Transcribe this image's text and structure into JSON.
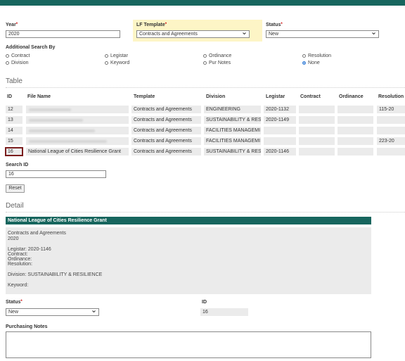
{
  "form": {
    "year_label": "Year",
    "year_value": "2020",
    "template_label": "LF Template",
    "template_value": "Contracts and Agreements",
    "status_label": "Status",
    "status_value": "New",
    "additional_label": "Additional Search By",
    "radios": [
      {
        "label": "Contract",
        "checked": false
      },
      {
        "label": "Legistar",
        "checked": false
      },
      {
        "label": "Ordinance",
        "checked": false
      },
      {
        "label": "Resolution",
        "checked": false
      },
      {
        "label": "Division",
        "checked": false
      },
      {
        "label": "Keyword",
        "checked": false
      },
      {
        "label": "Pur Notes",
        "checked": false
      },
      {
        "label": "None",
        "checked": true
      }
    ]
  },
  "table": {
    "section_title": "Table",
    "headers": [
      "ID",
      "File Name",
      "Template",
      "Division",
      "Legistar",
      "Contract",
      "Ordinance",
      "Resolution"
    ],
    "rows": [
      {
        "id": "12",
        "file_name": "",
        "template": "Contracts and Agreements",
        "division": "ENGINEERING",
        "legistar": "2020-1132",
        "contract": "",
        "ordinance": "",
        "resolution": "115-20"
      },
      {
        "id": "13",
        "file_name": "",
        "template": "Contracts and Agreements",
        "division": "SUSTAINABILITY & RES",
        "legistar": "2020-1149",
        "contract": "",
        "ordinance": "",
        "resolution": ""
      },
      {
        "id": "14",
        "file_name": "",
        "template": "Contracts and Agreements",
        "division": "FACILITIES MANAGEMI",
        "legistar": "",
        "contract": "",
        "ordinance": "",
        "resolution": ""
      },
      {
        "id": "15",
        "file_name": "",
        "template": "Contracts and Agreements",
        "division": "FACILITIES MANAGEMI",
        "legistar": "",
        "contract": "",
        "ordinance": "",
        "resolution": "223-20"
      },
      {
        "id": "16",
        "file_name": "National League of Cities Resilience Grant",
        "template": "Contracts and Agreements",
        "division": "SUSTAINABILITY & RES",
        "legistar": "2020-1146",
        "contract": "",
        "ordinance": "",
        "resolution": ""
      }
    ]
  },
  "search": {
    "label": "Search ID",
    "value": "16",
    "reset_label": "Reset"
  },
  "detail": {
    "section_title": "Detail",
    "header": "National League of Cities Resilience Grant",
    "template": "Contracts and Agreements",
    "year": "2020",
    "legistar": "Legistar: 2020-1146",
    "contract": "Contract:",
    "ordinance": "Ordinance:",
    "resolution": "Resolution:",
    "division": "Division: SUSTAINABILITY & RESILIENCE",
    "keyword": "Keyword:",
    "status_label": "Status",
    "status_value": "New",
    "id_label": "ID",
    "id_value": "16",
    "notes_label": "Purchasing Notes",
    "notes_value": ""
  },
  "colors": {
    "header_bar": "#17665e",
    "highlight": "#fdf5c6",
    "selected_outline": "#7a1d1d"
  }
}
